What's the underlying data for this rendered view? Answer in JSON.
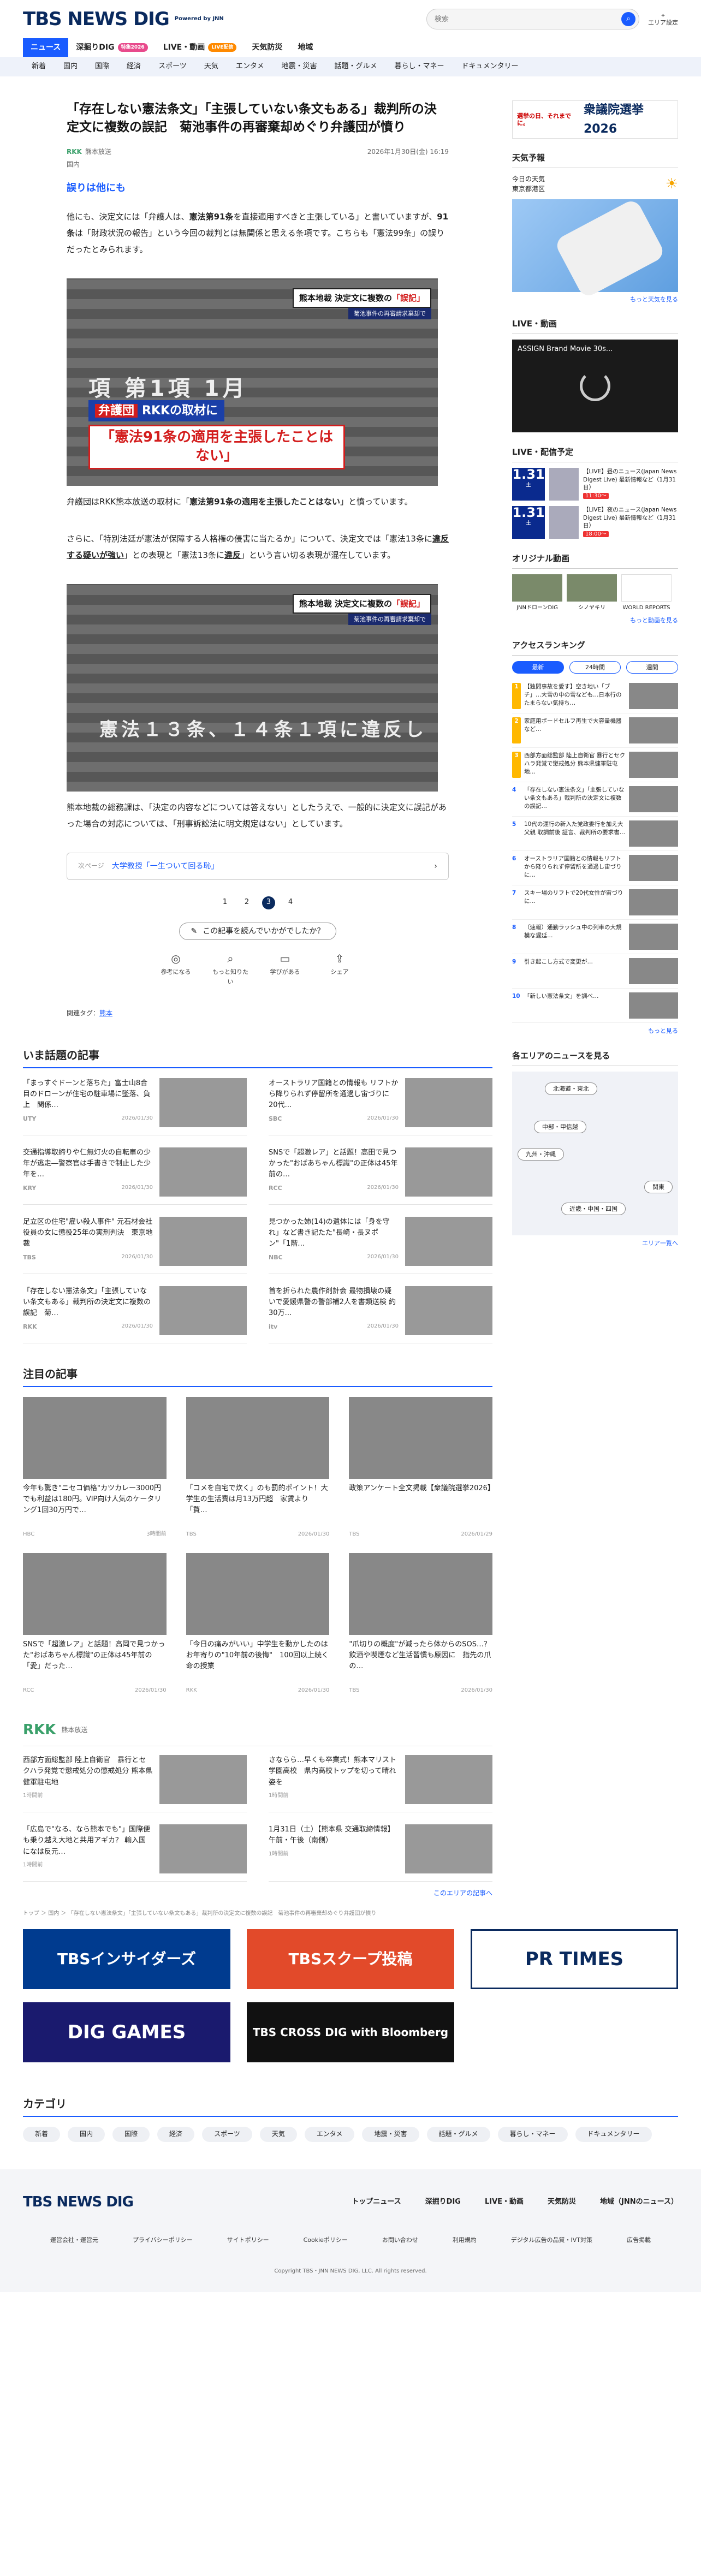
{
  "header": {
    "logo": "TBS NEWS DIG",
    "powered": "Powered by JNN",
    "search_placeholder": "検索",
    "area_label": "エリア設定"
  },
  "nav": {
    "tabs": [
      {
        "label": "ニュース",
        "active": true
      },
      {
        "label": "深掘りDIG",
        "badge": "特集2026"
      },
      {
        "label": "LIVE・動画",
        "badge": "LIVE配信"
      },
      {
        "label": "天気防災"
      },
      {
        "label": "地域"
      }
    ],
    "sub": [
      "新着",
      "国内",
      "国際",
      "経済",
      "スポーツ",
      "天気",
      "エンタメ",
      "地震・災害",
      "話題・グルメ",
      "暮らし・マネー",
      "ドキュメンタリー"
    ]
  },
  "article": {
    "title": "「存在しない憲法条文」「主張していない条文もある」裁判所の決定文に複数の誤記　菊池事件の再審棄却めぐり弁護団が憤り",
    "source": "RKK",
    "source_name": "熊本放送",
    "date": "2026年1月30日(金) 16:19",
    "tag_category": "国内",
    "heading": "誤りは他にも",
    "p1_a": "他にも、決定文には「弁護人は、",
    "p1_b": "憲法第91条",
    "p1_c": "を直接適用すべきと主張している」と書いていますが、",
    "p1_d": "91条",
    "p1_e": "は「財政状況の報告」という今回の裁判とは無関係と思える条項です。こちらも「憲法99条」の誤りだったとみられます。",
    "photo1_caption_a": "熊本地裁 決定文に複数の",
    "photo1_caption_b": "「誤記」",
    "photo1_sub": "菊池事件の再審請求棄却で",
    "photo1_band1_a": "弁護団",
    "photo1_band1_b": "RKKの取材に",
    "photo1_band2": "「憲法91条の適用を主張したことはない」",
    "photo1_bg": "項 第1項 1月",
    "p2_a": "弁護団はRKK熊本放送の取材に「",
    "p2_b": "憲法第91条の適用を主張したことはない",
    "p2_c": "」と憤っています。",
    "p3_a": "さらに、「特別法廷が憲法が保障する人格権の侵害に当たるか」について、決定文では「憲法13条に",
    "p3_b": "違反する疑いが強い",
    "p3_c": "」との表現と「憲法13条に",
    "p3_d": "違反",
    "p3_e": "」という言い切る表現が混在しています。",
    "photo2_bg": "憲法１３条、１４条１項に違反し",
    "p4": "熊本地裁の総務課は、「決定の内容などについては答えない」としたうえで、一般的に決定文に誤記があった場合の対応については、「刑事訴訟法に明文規定はない」としています。",
    "next_label": "次ページ",
    "next_title": "大学教授「一生ついて回る恥」",
    "pages": [
      "1",
      "2",
      "3",
      "4"
    ],
    "current_page": "3",
    "survey_q": "この記事を読んでいかがでしたか？",
    "survey_btns": [
      "参考になる",
      "もっと知りたい",
      "学びがある",
      "シェア"
    ],
    "tags_label": "関連タグ：",
    "tags_value": "熊本"
  },
  "trending": {
    "title": "いま話題の記事",
    "items": [
      {
        "text": "「まっすぐドーンと落ちた」富士山8合目のドローンが住宅の駐車場に墜落、負上　関係…",
        "src": "UTY",
        "time": "2026/01/30"
      },
      {
        "text": "オーストラリア国籍との情報も リフトから降りられず停留所を通過し宙づりに　20代…",
        "src": "SBC",
        "time": "2026/01/30"
      },
      {
        "text": "交通指導取締りや仁無灯火の自転車の少年が逃走―警察官は手書きで制止した少年を…",
        "src": "KRY",
        "time": "2026/01/30"
      },
      {
        "text": "SNSで「超激レア」と話題！高田で見つかった\"おばあちゃん標識\"の正体は45年前の…",
        "src": "RCC",
        "time": "2026/01/30"
      },
      {
        "text": "足立区の住宅\"雇い殺人事件\" 元石材会社役員の女に懲役25年の実刑判決　東京地裁",
        "src": "TBS",
        "time": "2026/01/30"
      },
      {
        "text": "見つかった姉(14)の遺体には「身を守れ」など書き記たた\"長崎・長ヌポン\"「1階…",
        "src": "NBC",
        "time": "2026/01/30"
      },
      {
        "text": "「存在しない憲法条文」「主張していない条文もある」裁判所の決定文に複数の誤記　菊…",
        "src": "RKK",
        "time": "2026/01/30"
      },
      {
        "text": "首を折られた農作剤計会 最物損壊の疑いで愛媛県警の警部補2人を書類送検 約30万…",
        "src": "itv",
        "time": "2026/01/30"
      }
    ]
  },
  "featured": {
    "title": "注目の記事",
    "items": [
      {
        "text": "今年も驚き\"ニセコ価格\"カツカレー3000円でも利益は180円。VIP向け人気のケータリング1回30万円で…",
        "src": "HBC",
        "time": "3時間前"
      },
      {
        "text": "「コメを自宅で炊く」のも罰的ポイント！大学生の生活費は月13万円超　家賃より「贅…",
        "src": "TBS",
        "time": "2026/01/30"
      },
      {
        "text": "政策アンケート全文掲載【衆議院選挙2026】",
        "src": "TBS",
        "time": "2026/01/29"
      },
      {
        "text": "SNSで「超激レア」と話題！高岡で見つかった\"おばあちゃん標識\"の正体は45年前の「愛」だった…",
        "src": "RCC",
        "time": "2026/01/30"
      },
      {
        "text": "「今日の痛みがいい」中学生を動かしたのはお年寄りの\"10年前の後悔\"　100回以上続く命の授業",
        "src": "RKK",
        "time": "2026/01/30"
      },
      {
        "text": "\"爪切りの概度\"が減ったら体からのSOS…？ 飲酒や喫煙など生活習慣も原因に　指先の爪の…",
        "src": "TBS",
        "time": "2026/01/30"
      }
    ]
  },
  "rkk_section": {
    "logo": "RKK",
    "name": "熊本放送",
    "items": [
      {
        "text": "西部方面総監部 陸上自衛官　暴行とセクハラ発覚で懲戒処分の懲戒処分 熊本県健軍駐屯地",
        "time": "1時間前"
      },
      {
        "text": "さならら…早くも卒業式！熊本マリスト学園高校　県内高校トップを切って晴れ姿を",
        "time": "1時間前"
      },
      {
        "text": "「広島で\"なる、なら熊本でも\"」国際便も乗り越え大地と共用アギカ？ 輸入国になは反元…",
        "time": "1時間前"
      },
      {
        "text": "1月31日（土）【熊本県 交通取締情報】午前・午後（南側）",
        "time": "1時間前"
      }
    ],
    "more": "このエリアの記事へ"
  },
  "crumb": "トップ ＞ 国内 ＞ 「存在しない憲法条文」「主張していない条文もある」裁判所の決定文に複数の誤記　菊池事件の再審棄却めぐり弁護団が憤り",
  "banners": [
    "TBSインサイダーズ",
    "TBSスクープ投稿",
    "PR TIMES",
    "DIG GAMES",
    "TBS CROSS DIG with Bloomberg"
  ],
  "categories": {
    "title": "カテゴリ",
    "items": [
      "新着",
      "国内",
      "国際",
      "経済",
      "スポーツ",
      "天気",
      "エンタメ",
      "地震・災害",
      "話題・グルメ",
      "暮らし・マネー",
      "ドキュメンタリー"
    ]
  },
  "sidebar": {
    "election_a": "選挙の日、それまでに。",
    "election_b": "衆議院選挙2026",
    "weather_title": "天気予報",
    "weather_today": "今日の天気",
    "weather_area": "東京都港区",
    "weather_more": "もっと天気を見る",
    "live_title": "LIVE・動画",
    "live_video": "ASSIGN Brand Movie 30s...",
    "prog_title": "LIVE・配信予定",
    "programs": [
      {
        "date": "1.31",
        "day": "土",
        "title": "【LIVE】昼のニュース(Japan News Digest Live) 最新情報など（1月31日）",
        "time": "11:30～"
      },
      {
        "date": "1.31",
        "day": "土",
        "title": "【LIVE】夜のニュース(Japan News Digest Live) 最新情報など（1月31日）",
        "time": "18:00～"
      }
    ],
    "ori_title": "オリジナル動画",
    "ori": [
      "JNNドローンDIG",
      "シノヤキリ",
      "WORLD REPORTS"
    ],
    "ori_more": "もっと動画を見る",
    "rank_title": "アクセスランキング",
    "rank_tabs": [
      "最新",
      "24時間",
      "週間"
    ],
    "ranks": [
      "【独問事故を愛す】空き地い「ブチ」…大雪の中の雪なども…日本行のたまらない気持ち…",
      "家庭用ボードセルフ再生で大容量機器など…",
      "西部方面総監部 陸上自衛官 暴行とセクハラ発覚で懲戒処分 熊本県健軍駐屯地…",
      "「存在しない憲法条文」「主張していない条文もある」裁判所の決定文に複数の誤記…",
      "10代の運行の新入た党政委行を加え大父親 取調前後 証言、裁判所の要求書…",
      "オーストラリア国籍との情報もリフトから降りられず停留所を通過し宙づりに…",
      "スキー場のリフトで20代女性が宙づりに…",
      "（速報）通勤ラッシュ中の列車の大規模な遅延…",
      "引き起こし方式で変更が…",
      "「新しい憲法条文」を調べ…"
    ],
    "rank_more": "もっと見る",
    "area_title": "各エリアのニュースを見る",
    "areas": [
      "北海道・東北",
      "中部・甲信越",
      "九州・沖縄",
      "関東",
      "近畿・中国・四国"
    ],
    "area_more": "エリア一覧へ"
  },
  "footer": {
    "links": [
      "トップニュース",
      "深掘りDIG",
      "LIVE・動画",
      "天気防災",
      "地域（JNNのニュース）"
    ],
    "sub": [
      "運営会社・運営元",
      "プライバシーポリシー",
      "サイトポリシー",
      "Cookieポリシー",
      "お問い合わせ",
      "利用規約",
      "デジタル広告の品質・IVT対策",
      "広告掲載"
    ],
    "copy": "Copyright TBS・JNN NEWS DIG, LLC. All rights reserved."
  }
}
